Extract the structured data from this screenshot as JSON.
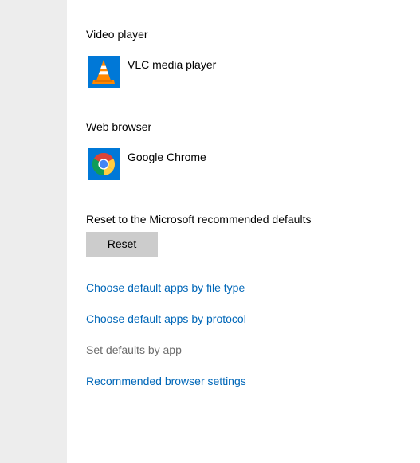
{
  "video_player": {
    "heading": "Video player",
    "app_name": "VLC media player",
    "icon": "vlc-cone-icon"
  },
  "web_browser": {
    "heading": "Web browser",
    "app_name": "Google Chrome",
    "icon": "chrome-icon"
  },
  "reset": {
    "heading": "Reset to the Microsoft recommended defaults",
    "button_label": "Reset"
  },
  "links": {
    "by_file_type": "Choose default apps by file type",
    "by_protocol": "Choose default apps by protocol",
    "by_app": "Set defaults by app",
    "browser_settings": "Recommended browser settings"
  },
  "colors": {
    "accent": "#0078d7",
    "link": "#0067b8",
    "disabled_text": "#6d6d6d",
    "button_bg": "#cccccc",
    "nav_strip": "#ededed"
  }
}
